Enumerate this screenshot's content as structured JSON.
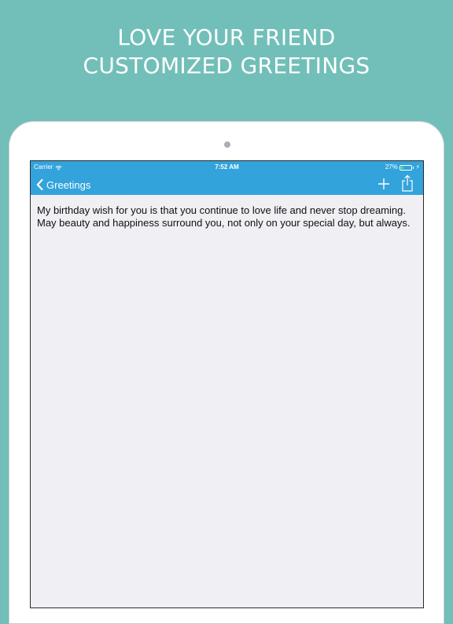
{
  "promo": {
    "line1": "LOVE YOUR FRIEND",
    "line2": "CUSTOMIZED GREETINGS"
  },
  "status_bar": {
    "carrier": "Carrier",
    "time": "7:52 AM",
    "battery_text": "27%",
    "battery_level": 0.27
  },
  "nav": {
    "back_label": "Greetings",
    "add_icon": "plus-icon",
    "share_icon": "share-icon"
  },
  "greeting": {
    "line1": "My birthday wish for you is that you continue to love life and never stop dreaming.",
    "line2": "May beauty and happiness surround you, not only on your special day, but always."
  },
  "colors": {
    "background": "#72bfb9",
    "navbar": "#33a3dc",
    "content": "#efeff4",
    "battery": "#5ee65e"
  }
}
